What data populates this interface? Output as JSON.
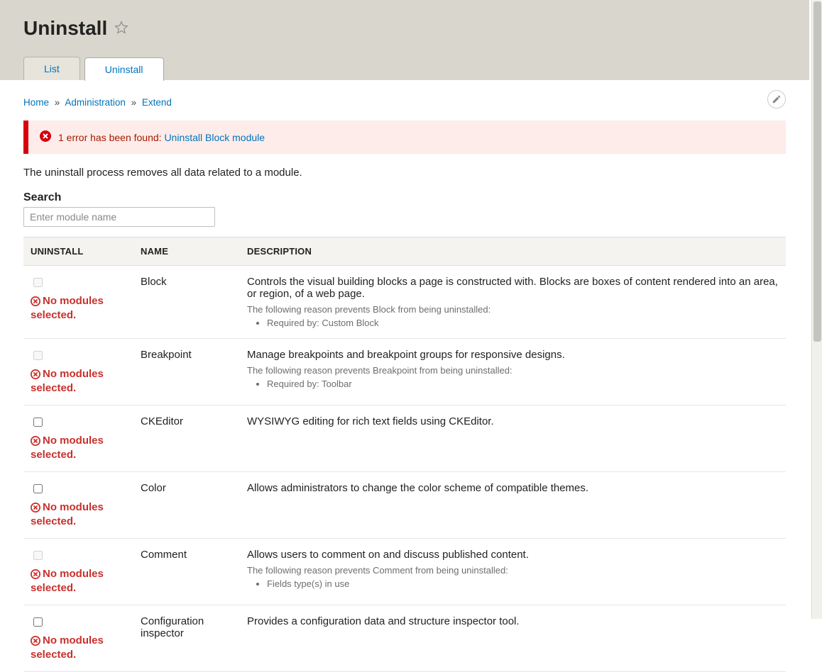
{
  "page_title": "Uninstall",
  "tabs": {
    "list": "List",
    "uninstall": "Uninstall"
  },
  "breadcrumbs": {
    "home": "Home",
    "administration": "Administration",
    "extend": "Extend",
    "sep": "»"
  },
  "error": {
    "prefix": "1 error has been found:",
    "link": "Uninstall Block module"
  },
  "intro": "The uninstall process removes all data related to a module.",
  "search": {
    "label": "Search",
    "placeholder": "Enter module name"
  },
  "table": {
    "headers": {
      "uninstall": "UNINSTALL",
      "name": "NAME",
      "description": "DESCRIPTION"
    },
    "no_modules_selected": "No modules selected."
  },
  "modules": [
    {
      "name": "Block",
      "disabled": true,
      "description": "Controls the visual building blocks a page is constructed with. Blocks are boxes of content rendered into an area, or region, of a web page.",
      "reason_prefix": "The following reason prevents Block from being uninstalled:",
      "reasons": [
        "Required by: Custom Block"
      ]
    },
    {
      "name": "Breakpoint",
      "disabled": true,
      "description": "Manage breakpoints and breakpoint groups for responsive designs.",
      "reason_prefix": "The following reason prevents Breakpoint from being uninstalled:",
      "reasons": [
        "Required by: Toolbar"
      ]
    },
    {
      "name": "CKEditor",
      "disabled": false,
      "description": "WYSIWYG editing for rich text fields using CKEditor.",
      "reason_prefix": "",
      "reasons": []
    },
    {
      "name": "Color",
      "disabled": false,
      "description": "Allows administrators to change the color scheme of compatible themes.",
      "reason_prefix": "",
      "reasons": []
    },
    {
      "name": "Comment",
      "disabled": true,
      "description": "Allows users to comment on and discuss published content.",
      "reason_prefix": "The following reason prevents Comment from being uninstalled:",
      "reasons": [
        "Fields type(s) in use"
      ]
    },
    {
      "name": "Configuration inspector",
      "disabled": false,
      "description": "Provides a configuration data and structure inspector tool.",
      "reason_prefix": "",
      "reasons": []
    }
  ]
}
